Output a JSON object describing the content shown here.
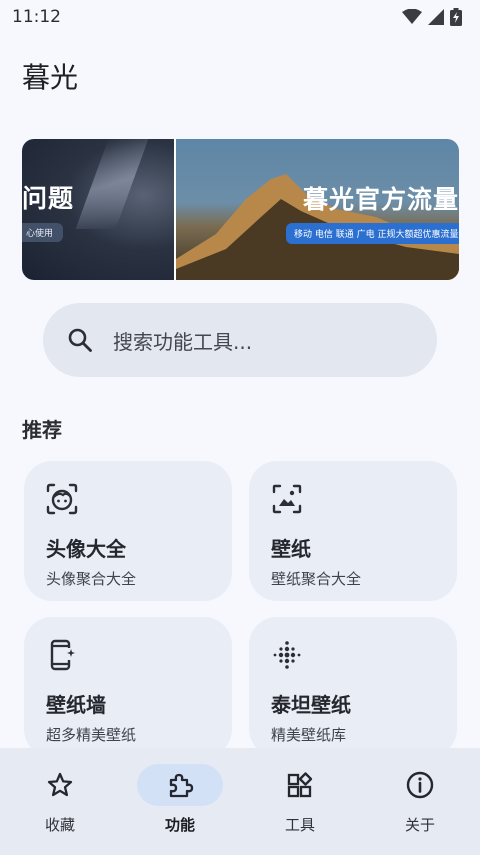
{
  "status": {
    "time": "11:12"
  },
  "app": {
    "title": "暮光"
  },
  "banner": {
    "left_text": "问题",
    "left_sub": "心使用",
    "right_text": "暮光官方流量",
    "right_sub": "移动 电信 联通 广电 正规大额超优惠流量卡"
  },
  "search": {
    "placeholder": "搜索功能工具..."
  },
  "section": {
    "title": "推荐"
  },
  "cards": [
    {
      "title": "头像大全",
      "subtitle": "头像聚合大全",
      "icon": "face-icon"
    },
    {
      "title": "壁纸",
      "subtitle": "壁纸聚合大全",
      "icon": "wallpaper-icon"
    },
    {
      "title": "壁纸墙",
      "subtitle": "超多精美壁纸",
      "icon": "phone-sparkle-icon"
    },
    {
      "title": "泰坦壁纸",
      "subtitle": "精美壁纸库",
      "icon": "dots-grid-icon"
    }
  ],
  "nav": [
    {
      "label": "收藏",
      "icon": "star-icon"
    },
    {
      "label": "功能",
      "icon": "puzzle-icon",
      "active": true
    },
    {
      "label": "工具",
      "icon": "widgets-icon"
    },
    {
      "label": "关于",
      "icon": "info-icon"
    }
  ],
  "colors": {
    "accent": "#d3e1f7",
    "background": "#f6f8fd",
    "card": "#e9edf5"
  }
}
